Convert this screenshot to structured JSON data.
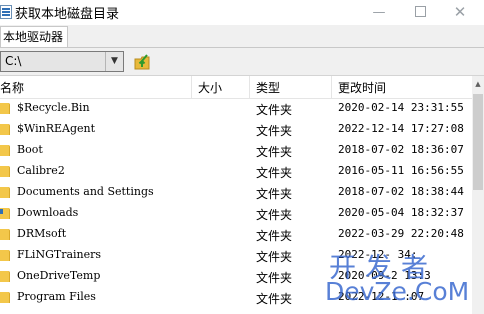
{
  "window": {
    "title": "获取本地磁盘目录",
    "min_glyph": "—",
    "close_glyph": "✕"
  },
  "tabs": [
    {
      "label": "本地驱动器"
    }
  ],
  "toolbar": {
    "drive_value": "C:\\",
    "dropdown_glyph": "▼",
    "up_button_icon": "folder-up-icon"
  },
  "list": {
    "columns": {
      "name": "名称",
      "size": "大小",
      "type": "类型",
      "modified": "更改时间"
    },
    "rows": [
      {
        "name": "$Recycle.Bin",
        "size": "",
        "type": "文件夹",
        "modified": "2020-02-14 23:31:55"
      },
      {
        "name": "$WinREAgent",
        "size": "",
        "type": "文件夹",
        "modified": "2022-12-14 17:27:08"
      },
      {
        "name": "Boot",
        "size": "",
        "type": "文件夹",
        "modified": "2018-07-02 18:36:07"
      },
      {
        "name": "Calibre2",
        "size": "",
        "type": "文件夹",
        "modified": "2016-05-11 16:56:55"
      },
      {
        "name": "Documents and Settings",
        "size": "",
        "type": "文件夹",
        "modified": "2018-07-02 18:38:44"
      },
      {
        "name": "Downloads",
        "size": "",
        "type": "文件夹",
        "modified": "2020-05-04 18:32:37"
      },
      {
        "name": "DRMsoft",
        "size": "",
        "type": "文件夹",
        "modified": "2022-03-29 22:20:48"
      },
      {
        "name": "FLiNGTrainers",
        "size": "",
        "type": "文件夹",
        "modified": "2022-12-  34:"
      },
      {
        "name": "OneDriveTemp",
        "size": "",
        "type": "文件夹",
        "modified": "2020-09-2  13:3"
      },
      {
        "name": "Program Files",
        "size": "",
        "type": "文件夹",
        "modified": "2022-12-1  :07"
      }
    ]
  },
  "watermark": {
    "line1": "开发者",
    "line2": "DevZe.CoM"
  },
  "colors": {
    "folder": "#f3c74a",
    "watermark": "#3c6bd0",
    "toolbar_bg": "#f0f0f0"
  }
}
